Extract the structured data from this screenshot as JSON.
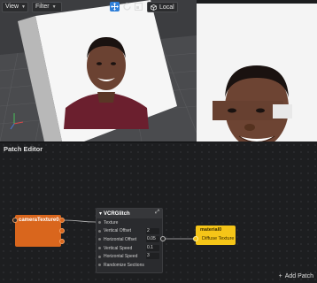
{
  "toolbar": {
    "view_label": "View",
    "filter_label": "Filter",
    "local_label": "Local"
  },
  "icons": {
    "move": "move-arrows-icon",
    "rotate": "rotate-icon",
    "scale": "scale-icon",
    "space": "cube-icon"
  },
  "patch_editor": {
    "title": "Patch Editor",
    "add_patch_label": "Add Patch"
  },
  "nodes": {
    "camera": {
      "label": "cameraTexture0"
    },
    "glitch": {
      "title": "VCRGlitch",
      "rows": [
        {
          "label": "Texture",
          "value": ""
        },
        {
          "label": "Vertical Offset",
          "value": "2"
        },
        {
          "label": "Horizontal Offset",
          "value": "0.05"
        },
        {
          "label": "Vertical Speed",
          "value": "0.1"
        },
        {
          "label": "Horizontal Speed",
          "value": "3"
        },
        {
          "label": "Randomize Sections",
          "value": ""
        }
      ]
    },
    "material": {
      "name": "material0",
      "property": "Diffuse Texture"
    }
  },
  "colors": {
    "camera_node": "#d9661d",
    "material_node": "#f5c518",
    "active_tool": "#2f7fd8"
  }
}
